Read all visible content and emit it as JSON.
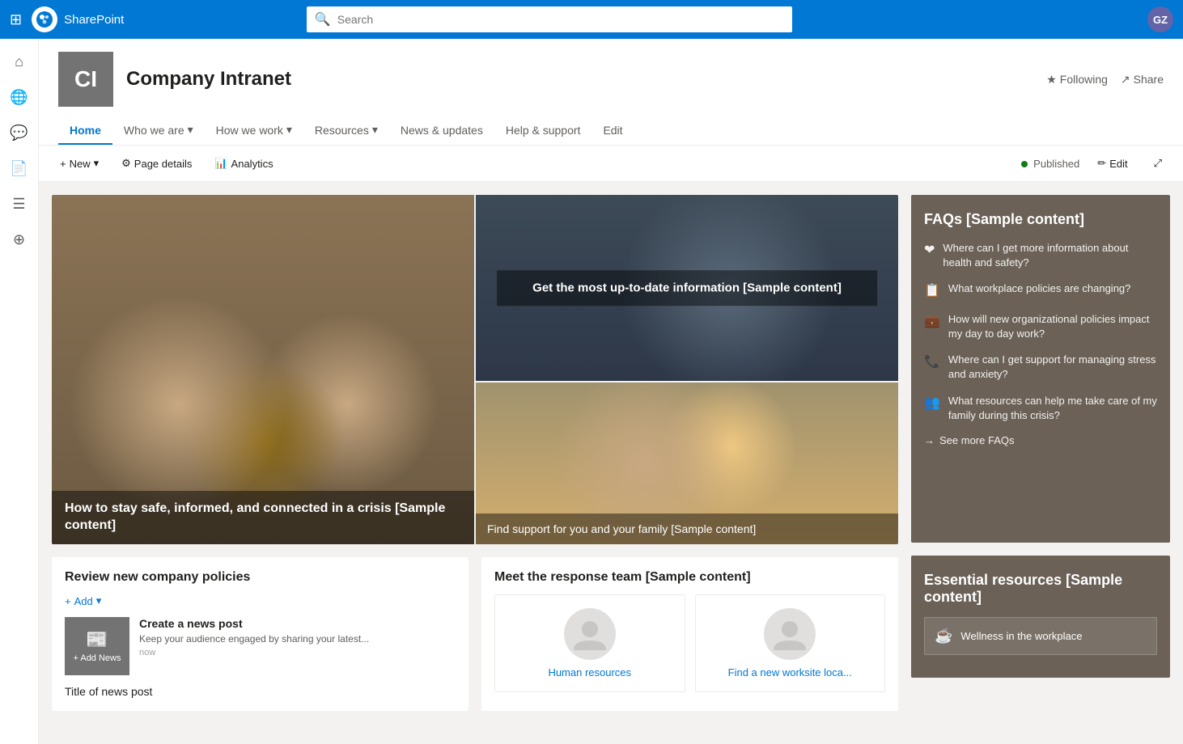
{
  "topnav": {
    "app_name": "SharePoint",
    "search_placeholder": "Search",
    "avatar_initials": "GZ",
    "waffle_icon": "⊞"
  },
  "left_sidebar": {
    "icons": [
      {
        "name": "home-icon",
        "symbol": "⌂"
      },
      {
        "name": "globe-icon",
        "symbol": "🌐"
      },
      {
        "name": "chat-icon",
        "symbol": "💬"
      },
      {
        "name": "document-icon",
        "symbol": "📄"
      },
      {
        "name": "list-icon",
        "symbol": "☰"
      },
      {
        "name": "add-circle-icon",
        "symbol": "⊕"
      }
    ]
  },
  "site_header": {
    "logo_text": "CI",
    "site_title": "Company Intranet",
    "nav_items": [
      {
        "label": "Home",
        "active": true
      },
      {
        "label": "Who we are",
        "has_dropdown": true
      },
      {
        "label": "How we work",
        "has_dropdown": true
      },
      {
        "label": "Resources",
        "has_dropdown": true
      },
      {
        "label": "News & updates",
        "has_dropdown": false
      },
      {
        "label": "Help & support",
        "has_dropdown": false
      },
      {
        "label": "Edit",
        "has_dropdown": false
      }
    ],
    "following_label": "Following",
    "share_label": "Share"
  },
  "toolbar": {
    "new_label": "New",
    "page_details_label": "Page details",
    "analytics_label": "Analytics",
    "published_label": "Published",
    "edit_label": "Edit",
    "expand_label": "⤢"
  },
  "hero": {
    "card1_caption": "How to stay safe, informed, and connected in a crisis [Sample content]",
    "card2_caption": "Get the most up-to-date information [Sample content]",
    "card3_caption": "Find support for you and your family [Sample content]"
  },
  "policies_section": {
    "title": "Review new company policies",
    "add_label": "Add",
    "news_post_title": "Create a news post",
    "news_post_desc": "Keep your audience engaged by sharing your latest...",
    "news_post_time": "now",
    "add_news_label": "+ Add News",
    "news_title_label": "Title of news post"
  },
  "team_section": {
    "title": "Meet the response team [Sample content]",
    "team_members": [
      {
        "label": "Human resources"
      },
      {
        "label": "Find a new worksite loca..."
      }
    ]
  },
  "faqs": {
    "title": "FAQs [Sample content]",
    "items": [
      {
        "icon": "❤",
        "text": "Where can I get more information about health and safety?"
      },
      {
        "icon": "📋",
        "text": "What workplace policies are changing?"
      },
      {
        "icon": "💼",
        "text": "How will new organizational policies impact my day to day work?"
      },
      {
        "icon": "📞",
        "text": "Where can I get support for managing stress and anxiety?"
      },
      {
        "icon": "👥",
        "text": "What resources can help me take care of my family during this crisis?"
      }
    ],
    "see_more_label": "See more FAQs"
  },
  "essential_resources": {
    "title": "Essential resources [Sample content]",
    "items": [
      {
        "icon": "☕",
        "text": "Wellness in the workplace"
      }
    ]
  }
}
